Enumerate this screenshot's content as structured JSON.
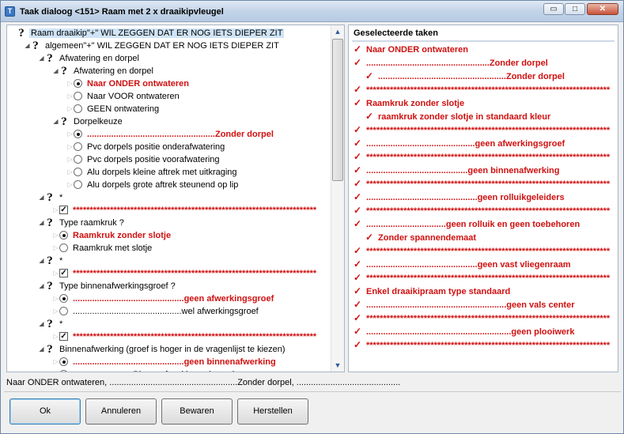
{
  "window": {
    "title": "Taak dialoog <151> Raam met 2 x draaikipvleugel",
    "min_glyph": "▭",
    "max_glyph": "□",
    "close_glyph": "✕"
  },
  "tree": {
    "rows": [
      {
        "label": "Raam draaikip\"+\" WIL ZEGGEN DAT ER NOG IETS DIEPER ZIT",
        "level": 0
      },
      {
        "label": "algemeen\"+\" WIL ZEGGEN DAT ER NOG IETS DIEPER ZIT",
        "level": 1
      },
      {
        "label": "Afwatering en dorpel",
        "level": 2
      },
      {
        "label": "Afwatering en dorpel",
        "level": 3
      },
      {
        "label": "Naar ONDER ontwateren",
        "level": 4,
        "checked": true,
        "style": "red"
      },
      {
        "label": "Naar VOOR ontwateren",
        "level": 4
      },
      {
        "label": "GEEN ontwatering",
        "level": 4
      },
      {
        "label": "Dorpelkeuze",
        "level": 3
      },
      {
        "label": ".....................................................Zonder dorpel",
        "level": 4,
        "checked": true,
        "style": "red"
      },
      {
        "label": "Pvc dorpels positie onderafwatering",
        "level": 4
      },
      {
        "label": "Pvc dorpels positie voorafwatering",
        "level": 4
      },
      {
        "label": "Alu dorpels kleine aftrek met uitkraging",
        "level": 4
      },
      {
        "label": "Alu dorpels grote aftrek steunend op lip",
        "level": 4
      },
      {
        "label": "*",
        "level": 2
      },
      {
        "label": "************************************************************************",
        "level": 3,
        "style": "red"
      },
      {
        "label": "Type raamkruk ?",
        "level": 2
      },
      {
        "label": "Raamkruk zonder slotje",
        "level": 3,
        "checked": true,
        "style": "red"
      },
      {
        "label": "Raamkruk met slotje",
        "level": 3
      },
      {
        "label": "*",
        "level": 2
      },
      {
        "label": "************************************************************************",
        "level": 3,
        "style": "red"
      },
      {
        "label": "Type binnenafwerkingsgroef ?",
        "level": 2
      },
      {
        "label": "..............................................geen afwerkingsgroef",
        "level": 3,
        "checked": true,
        "style": "red"
      },
      {
        "label": ".............................................wel afwerkingsgroef",
        "level": 3
      },
      {
        "label": "*",
        "level": 2
      },
      {
        "label": "************************************************************************",
        "level": 3,
        "style": "red"
      },
      {
        "label": "Binnenafwerking (groef is hoger in de vragenlijst te kiezen)",
        "level": 2
      },
      {
        "label": "..............................................geen binnenafwerking",
        "level": 3,
        "checked": true,
        "style": "red"
      },
      {
        "label": "........................ Binnenafwerking volgens keuze",
        "level": 3
      }
    ]
  },
  "tasks": {
    "header": "Geselecteerde taken",
    "items": [
      {
        "text": "Naar ONDER ontwateren",
        "indent": false
      },
      {
        "text": "...................................................Zonder dorpel",
        "indent": false
      },
      {
        "text": ".....................................................Zonder dorpel",
        "indent": true
      },
      {
        "text": "************************************************************************",
        "indent": false
      },
      {
        "text": "Raamkruk zonder slotje",
        "indent": false
      },
      {
        "text": "raamkruk zonder slotje in standaard kleur",
        "indent": true
      },
      {
        "text": "************************************************************************",
        "indent": false
      },
      {
        "text": ".............................................geen afwerkingsgroef",
        "indent": false
      },
      {
        "text": "************************************************************************",
        "indent": false
      },
      {
        "text": "..........................................geen binnenafwerking",
        "indent": false
      },
      {
        "text": "************************************************************************",
        "indent": false
      },
      {
        "text": "..............................................geen rolluikgeleiders",
        "indent": false
      },
      {
        "text": "************************************************************************",
        "indent": false
      },
      {
        "text": ".................................geen rolluik en geen toebehoren",
        "indent": false
      },
      {
        "text": "Zonder spannendemaat",
        "indent": true
      },
      {
        "text": "************************************************************************",
        "indent": false
      },
      {
        "text": "..............................................geen vast vliegenraam",
        "indent": false
      },
      {
        "text": "************************************************************************",
        "indent": false
      },
      {
        "text": "Enkel draaikipraam type standaard",
        "indent": false
      },
      {
        "text": "..........................................................geen vals center",
        "indent": false
      },
      {
        "text": "************************************************************************",
        "indent": false
      },
      {
        "text": "............................................................geen plooiwerk",
        "indent": false
      },
      {
        "text": "************************************************************************",
        "indent": false
      }
    ]
  },
  "status": {
    "text": "Naar ONDER ontwateren, .....................................................Zonder dorpel, ..........................................."
  },
  "buttons": {
    "ok": "Ok",
    "cancel": "Annuleren",
    "save": "Bewaren",
    "reset": "Herstellen"
  }
}
